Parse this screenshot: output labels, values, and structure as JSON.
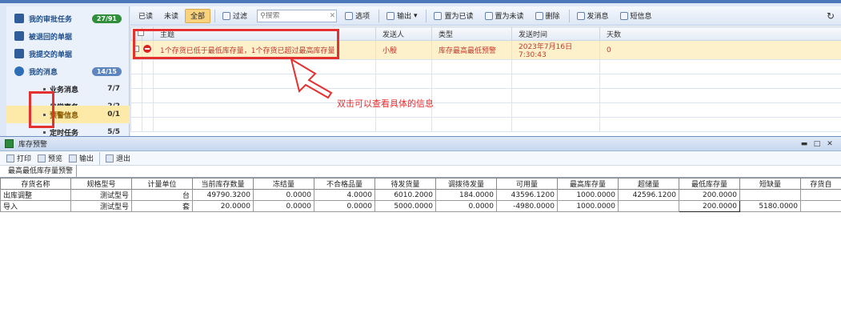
{
  "sidebar": {
    "items": [
      {
        "label": "我的审批任务",
        "badge": "27/91",
        "icon": "clipboard-icon"
      },
      {
        "label": "被退回的单据",
        "icon": "return-doc-icon"
      },
      {
        "label": "我提交的单据",
        "icon": "submit-doc-icon"
      },
      {
        "label": "我的消息",
        "badge": "14/15",
        "icon": "chat-bubble-icon"
      }
    ],
    "sub_items": [
      {
        "label": "业务消息",
        "count": "7/7"
      },
      {
        "label": "日常事务",
        "count": "2/2"
      },
      {
        "label": "预警信息",
        "count": "0/1"
      },
      {
        "label": "定时任务",
        "count": "5/5"
      }
    ]
  },
  "toolbar": {
    "read": "已读",
    "unread": "未读",
    "all": "全部",
    "filter": "过滤",
    "search_placeholder": "搜索",
    "options": "选项",
    "export": "输出",
    "mark_read": "置为已读",
    "mark_unread": "置为未读",
    "delete": "删除",
    "send_message": "发消息",
    "sms": "短信息"
  },
  "message_table": {
    "headers": [
      "主题",
      "发送人",
      "类型",
      "发送时间",
      "天数"
    ],
    "row": {
      "subject": "1个存货已低于最低库存量，1个存货已超过最高库存量",
      "sender": "小殷",
      "type": "库存最高最低预警",
      "time": "2023年7月16日 7:30:43",
      "days": "0"
    }
  },
  "annotation": "双击可以查看具体的信息",
  "colors": {
    "accent_red": "#e53030",
    "selected_row": "#fdf1cc",
    "badge_green": "#2f8f3a"
  },
  "window": {
    "title": "库存预警",
    "toolbar": {
      "print": "打印",
      "preview": "预览",
      "export": "输出",
      "exit": "退出"
    },
    "tab": "最高最低库存量预警",
    "headers": [
      "存货名称",
      "规格型号",
      "计量单位",
      "当前库存数量",
      "冻结量",
      "不合格品量",
      "待发货量",
      "调拨待发量",
      "可用量",
      "最高库存量",
      "超储量",
      "最低库存量",
      "短缺量",
      "存货自"
    ],
    "rows": [
      [
        "出库调整",
        "测试型号",
        "台",
        "49790.3200",
        "0.0000",
        "4.0000",
        "6010.2000",
        "184.0000",
        "43596.1200",
        "1000.0000",
        "42596.1200",
        "200.0000",
        "",
        ""
      ],
      [
        "导入",
        "测试型号",
        "套",
        "20.0000",
        "0.0000",
        "0.0000",
        "5000.0000",
        "0.0000",
        "-4980.0000",
        "1000.0000",
        "",
        "200.0000",
        "5180.0000",
        ""
      ]
    ]
  }
}
